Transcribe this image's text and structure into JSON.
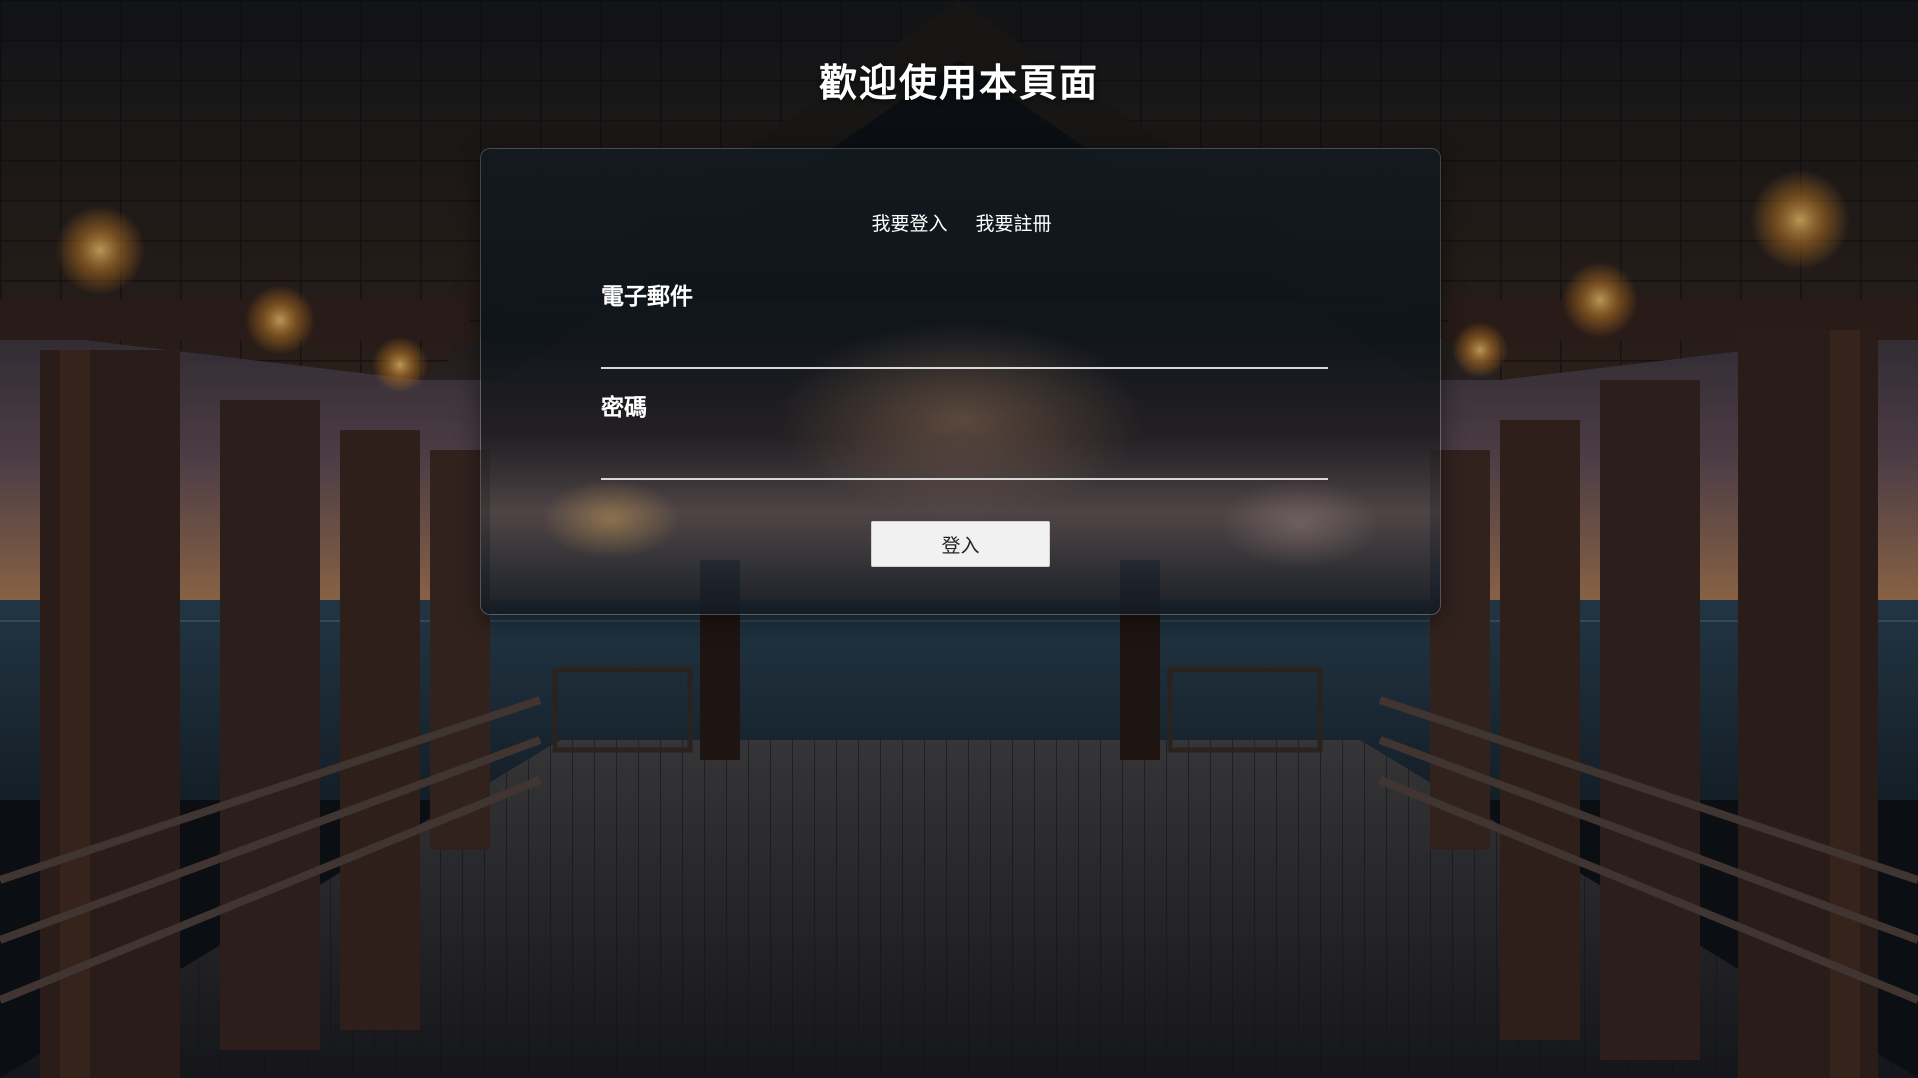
{
  "page": {
    "title": "歡迎使用本頁面",
    "background": "pier-at-sunset-photo"
  },
  "tabs": [
    {
      "label": "我要登入"
    },
    {
      "label": "我要註冊"
    }
  ],
  "form": {
    "email_label": "電子郵件",
    "email_value": "",
    "password_label": "密碼",
    "password_value": "",
    "submit_label": "登入"
  },
  "colors": {
    "text": "#ffffff",
    "button_bg": "#f1f1f1",
    "button_text": "#222222",
    "underline": "#d8d8d8"
  }
}
